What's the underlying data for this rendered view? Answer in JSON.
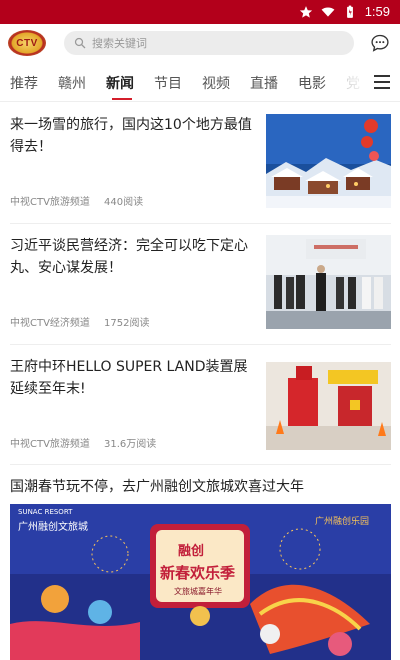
{
  "status_bar": {
    "time": "1:59"
  },
  "header": {
    "logo_text": "CTV",
    "search_placeholder": "搜索关键词"
  },
  "tabs": [
    {
      "label": "推荐",
      "active": false
    },
    {
      "label": "赣州",
      "active": false
    },
    {
      "label": "新闻",
      "active": true
    },
    {
      "label": "节目",
      "active": false
    },
    {
      "label": "视频",
      "active": false
    },
    {
      "label": "直播",
      "active": false
    },
    {
      "label": "电影",
      "active": false
    },
    {
      "label": "党",
      "active": false
    }
  ],
  "articles": [
    {
      "title": "来一场雪的旅行，国内这10个地方最值得去！",
      "source": "中视CTV旅游频道",
      "reads": "440阅读"
    },
    {
      "title": "习近平谈民营经济：完全可以吃下定心丸、安心谋发展！",
      "source": "中视CTV经济频道",
      "reads": "1752阅读"
    },
    {
      "title": "王府中环HELLO SUPER LAND装置展延续至年末!",
      "source": "中视CTV旅游频道",
      "reads": "31.6万阅读"
    }
  ],
  "featured": {
    "title": "国潮春节玩不停，去广州融创文旅城欢喜过大年",
    "image_text": {
      "top_left_small": "SUNAC RESORT",
      "top_left": "广州融创文旅城",
      "top_right": "广州融创乐园",
      "center_top": "融创",
      "center_main": "新春欢乐季",
      "center_sub": "文旅城嘉年华"
    }
  },
  "colors": {
    "status_bar": "#b3001b",
    "accent": "#d41e2b"
  }
}
